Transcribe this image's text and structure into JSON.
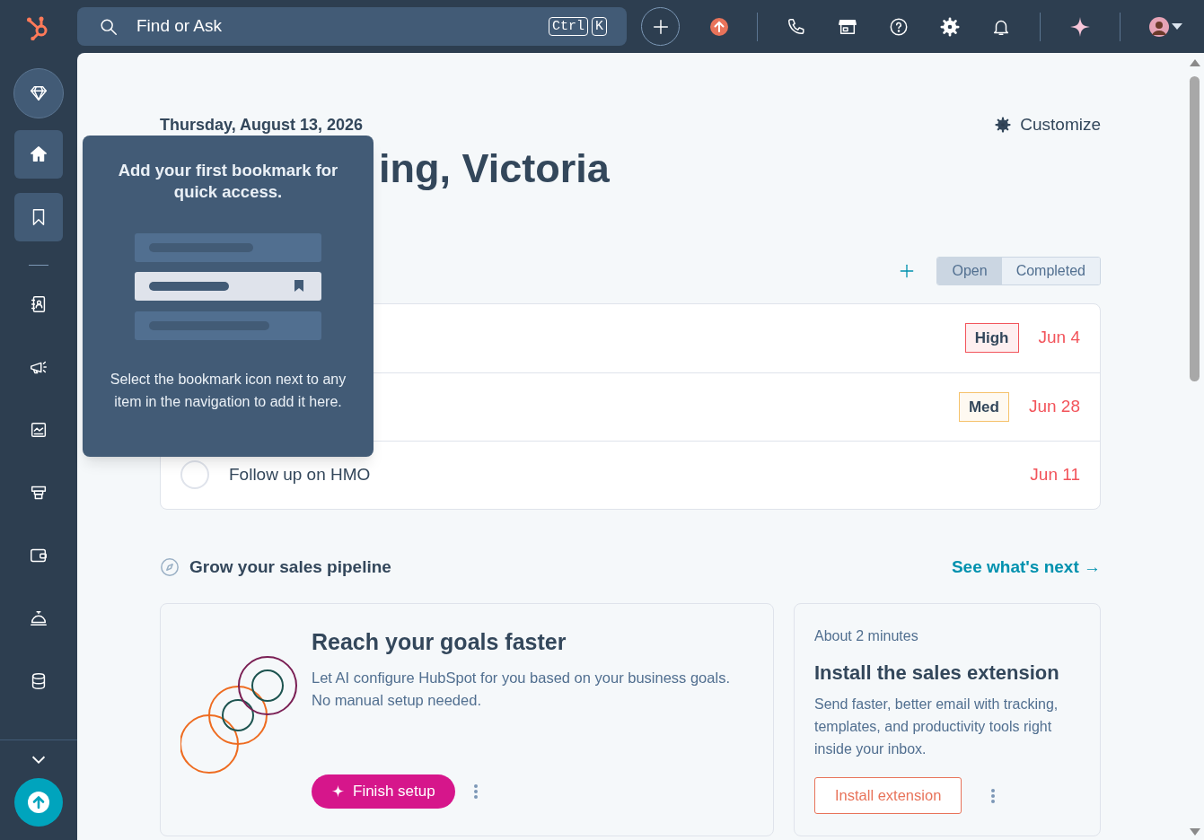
{
  "topbar": {
    "search": {
      "placeholder": "Find or Ask",
      "shortcut_keys": [
        "Ctrl",
        "K"
      ]
    }
  },
  "sidebar": {
    "items": [
      {
        "selected": false
      },
      {
        "selected": true
      },
      {
        "selected": true
      },
      {
        "selected": false
      },
      {
        "selected": false
      },
      {
        "selected": false
      },
      {
        "selected": false
      },
      {
        "selected": false
      },
      {
        "selected": false
      },
      {
        "selected": false
      }
    ]
  },
  "bookmark_popover": {
    "title": "Add your first bookmark for quick access.",
    "body": "Select the bookmark icon next to any item in the navigation to add it here."
  },
  "date": "Thursday, August 13, 2026",
  "greeting": "ing, Victoria",
  "customize": "Customize",
  "tasks": {
    "tabs": [
      {
        "label": "Open",
        "selected": true
      },
      {
        "label": "Completed",
        "selected": false
      }
    ],
    "rows": [
      {
        "priority": "High",
        "color": "#f2545b",
        "due": "Jun 4"
      },
      {
        "priority": "Med",
        "color": "#f5c26b",
        "due": "Jun 28"
      },
      {
        "title": "Follow up on HMO",
        "checked": false,
        "due": "Jun 11"
      }
    ]
  },
  "pipeline": {
    "title": "Grow your sales pipeline",
    "link": "See what's next →",
    "cards": [
      {
        "kind": "setup",
        "title": "Reach your goals faster",
        "body": "Let AI configure HubSpot for you based on your business goals. No manual setup needed.",
        "button": "Finish setup"
      },
      {
        "kind": "extension",
        "eyebrow": "About 2 minutes",
        "title": "Install the sales extension",
        "body": "Send faster, better email with tracking, templates, and productivity tools right inside your inbox.",
        "button": "Install extension"
      }
    ]
  }
}
